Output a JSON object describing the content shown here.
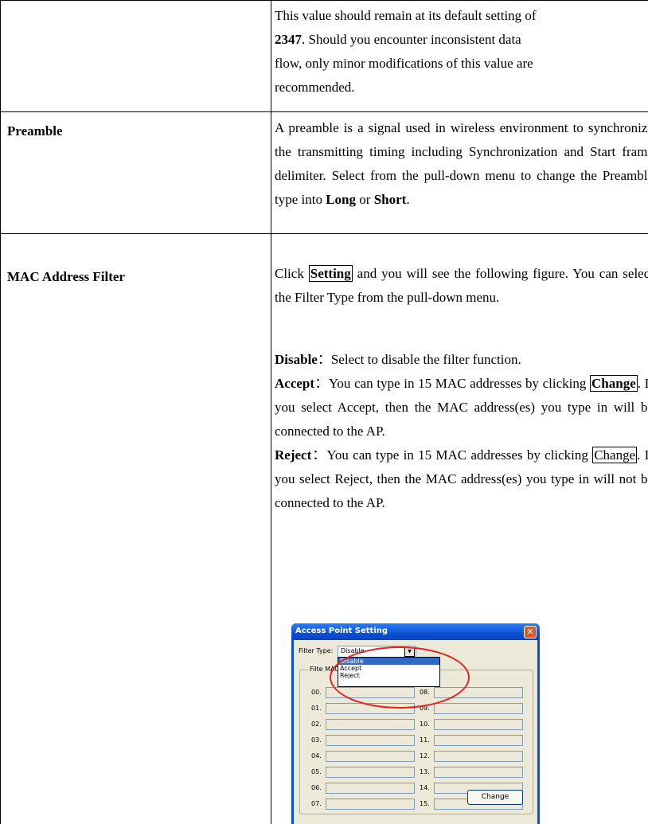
{
  "rts_section": {
    "line1": "This value should remain at its default setting of",
    "value": "2347",
    "line2": ".   Should you encounter inconsistent data",
    "line3": "flow, only minor modifications of this value are",
    "line4": "recommended."
  },
  "preamble": {
    "label": "Preamble",
    "text": "A preamble is a signal used in wireless environment to synchronize the transmitting timing including Synchronization and Start frame delimiter. Select from the pull-down menu to change the Preamble type into",
    "opt_long": "Long",
    "or": " or ",
    "opt_short": "Short",
    "end": "."
  },
  "mac_filter": {
    "label": "MAC Address Filter",
    "intro_pre": "Click ",
    "setting_btn": "Setting",
    "intro_post": " and you will see the following figure. You can select the Filter Type from the pull-down menu.",
    "disable_term": "Disable",
    "disable_text": "：Select to disable the filter function.",
    "accept_term": "Accept",
    "accept_pre": "：You can type in 15 MAC addresses by clicking ",
    "accept_change": "Change",
    "accept_post": ". If you select Accept, then the MAC address(es) you type in will be connected to the AP.",
    "reject_term": "Reject",
    "reject_pre": "：You can type in 15 MAC addresses by clicking ",
    "reject_change": "Change",
    "reject_post": ". If you select Reject, then the MAC address(es) you type in will not be connected to the AP."
  },
  "dialog": {
    "title": "Access Point Setting",
    "filter_type_label": "Filter Type:",
    "selected": "Disable",
    "options": [
      "Disable",
      "Accept",
      "Reject"
    ],
    "group_title": "Filte MAC A",
    "left_rows": [
      "00.",
      "01.",
      "02.",
      "03.",
      "04.",
      "05.",
      "06.",
      "07."
    ],
    "right_rows": [
      "08.",
      "09.",
      "10.",
      "11.",
      "12.",
      "13.",
      "14.",
      "15."
    ],
    "change_button": "Change"
  },
  "colors": {
    "title_bar": "#0a4fd0",
    "dialog_bg": "#ece9d8",
    "highlight_oval": "#e8201c",
    "selection": "#316ac5"
  }
}
